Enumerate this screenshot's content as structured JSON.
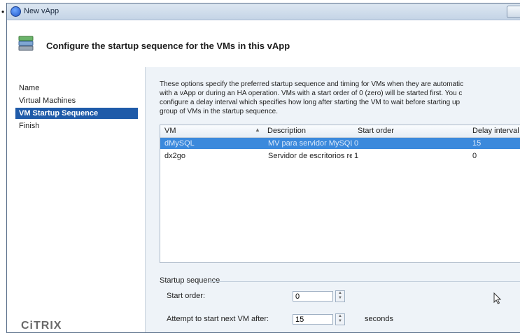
{
  "window": {
    "title": "New vApp"
  },
  "header": {
    "title": "Configure the startup sequence for the VMs in this vApp"
  },
  "sidebar": {
    "items": [
      {
        "label": "Name"
      },
      {
        "label": "Virtual Machines"
      },
      {
        "label": "VM Startup Sequence"
      },
      {
        "label": "Finish"
      }
    ],
    "active_index": 2
  },
  "branding": {
    "logo_text": "CiTRIX"
  },
  "main": {
    "description": [
      "These options specify the preferred startup sequence and timing for VMs when they are automatic",
      "with a vApp or during an HA operation. VMs with a start order of 0 (zero) will be started first. You c",
      "configure a delay interval which specifies how long after starting the VM to wait before starting up",
      "group of VMs in the startup sequence."
    ],
    "table": {
      "columns": [
        "VM",
        "Description",
        "Start order",
        "Delay interval"
      ],
      "rows": [
        {
          "vm": "dMySQL",
          "description": "MV para servidor MySQL",
          "start_order": "0",
          "delay": "15"
        },
        {
          "vm": "dx2go",
          "description": "Servidor de escritorios re...",
          "start_order": "1",
          "delay": "0"
        }
      ],
      "selected_index": 0
    },
    "startup_sequence": {
      "group_label": "Startup sequence",
      "start_order_label": "Start order:",
      "start_order_value": "0",
      "attempt_label": "Attempt to start next VM after:",
      "attempt_value": "15",
      "seconds_label": "seconds"
    }
  },
  "colors": {
    "selection": "#3b89dc",
    "nav_active": "#1f5ba9",
    "panel_bg": "#eef3f8"
  }
}
